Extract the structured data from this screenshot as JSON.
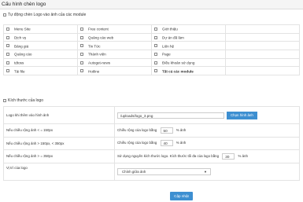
{
  "header": {
    "title": "Cấu hình chèn logo"
  },
  "auto_section": {
    "label": "Tự động chèn Logo vào ảnh của các module"
  },
  "modules": [
    [
      "Menu Site",
      "Free content",
      "Giới thiệu"
    ],
    [
      "Dịch vụ",
      "Quảng cáo web",
      "Dự án đã làm"
    ],
    [
      "Bảng giá",
      "Tin Tức",
      "Liên hệ"
    ],
    [
      "Quảng cáo",
      "Thành viên",
      "Page"
    ],
    [
      "tdtoss",
      "Autoget-news",
      "Điều khoản sử dụng"
    ],
    [
      "Tải file",
      "Hotline",
      "Tất cả các module"
    ]
  ],
  "size_section": {
    "label": "Kích thước của logo"
  },
  "logo_row": {
    "label": "Logo khi thêm vào hình ảnh",
    "value": "/uploads/logo_3.png",
    "button": "Chọn hình ảnh"
  },
  "rows": [
    {
      "label": "Nếu chiều rộng ảnh < = 150px",
      "before": "Chiều rộng của logo bằng",
      "value": "50",
      "after": "% ảnh"
    },
    {
      "label": "Nếu chiều rộng ảnh > 150px, < 350px",
      "before": "Chiều rộng của logo bằng",
      "value": "40",
      "after": "% ảnh"
    },
    {
      "label": "Nếu chiều rộng ảnh > = 350px",
      "before": "Sử dụng nguyên kích thước logo. Kích thước tối đa của logo bằng",
      "value": "30",
      "after": "% ảnh"
    }
  ],
  "position_row": {
    "label": "Vị trí của logo",
    "selected": "Chính giữa ảnh"
  },
  "save_button": "Cập nhật"
}
